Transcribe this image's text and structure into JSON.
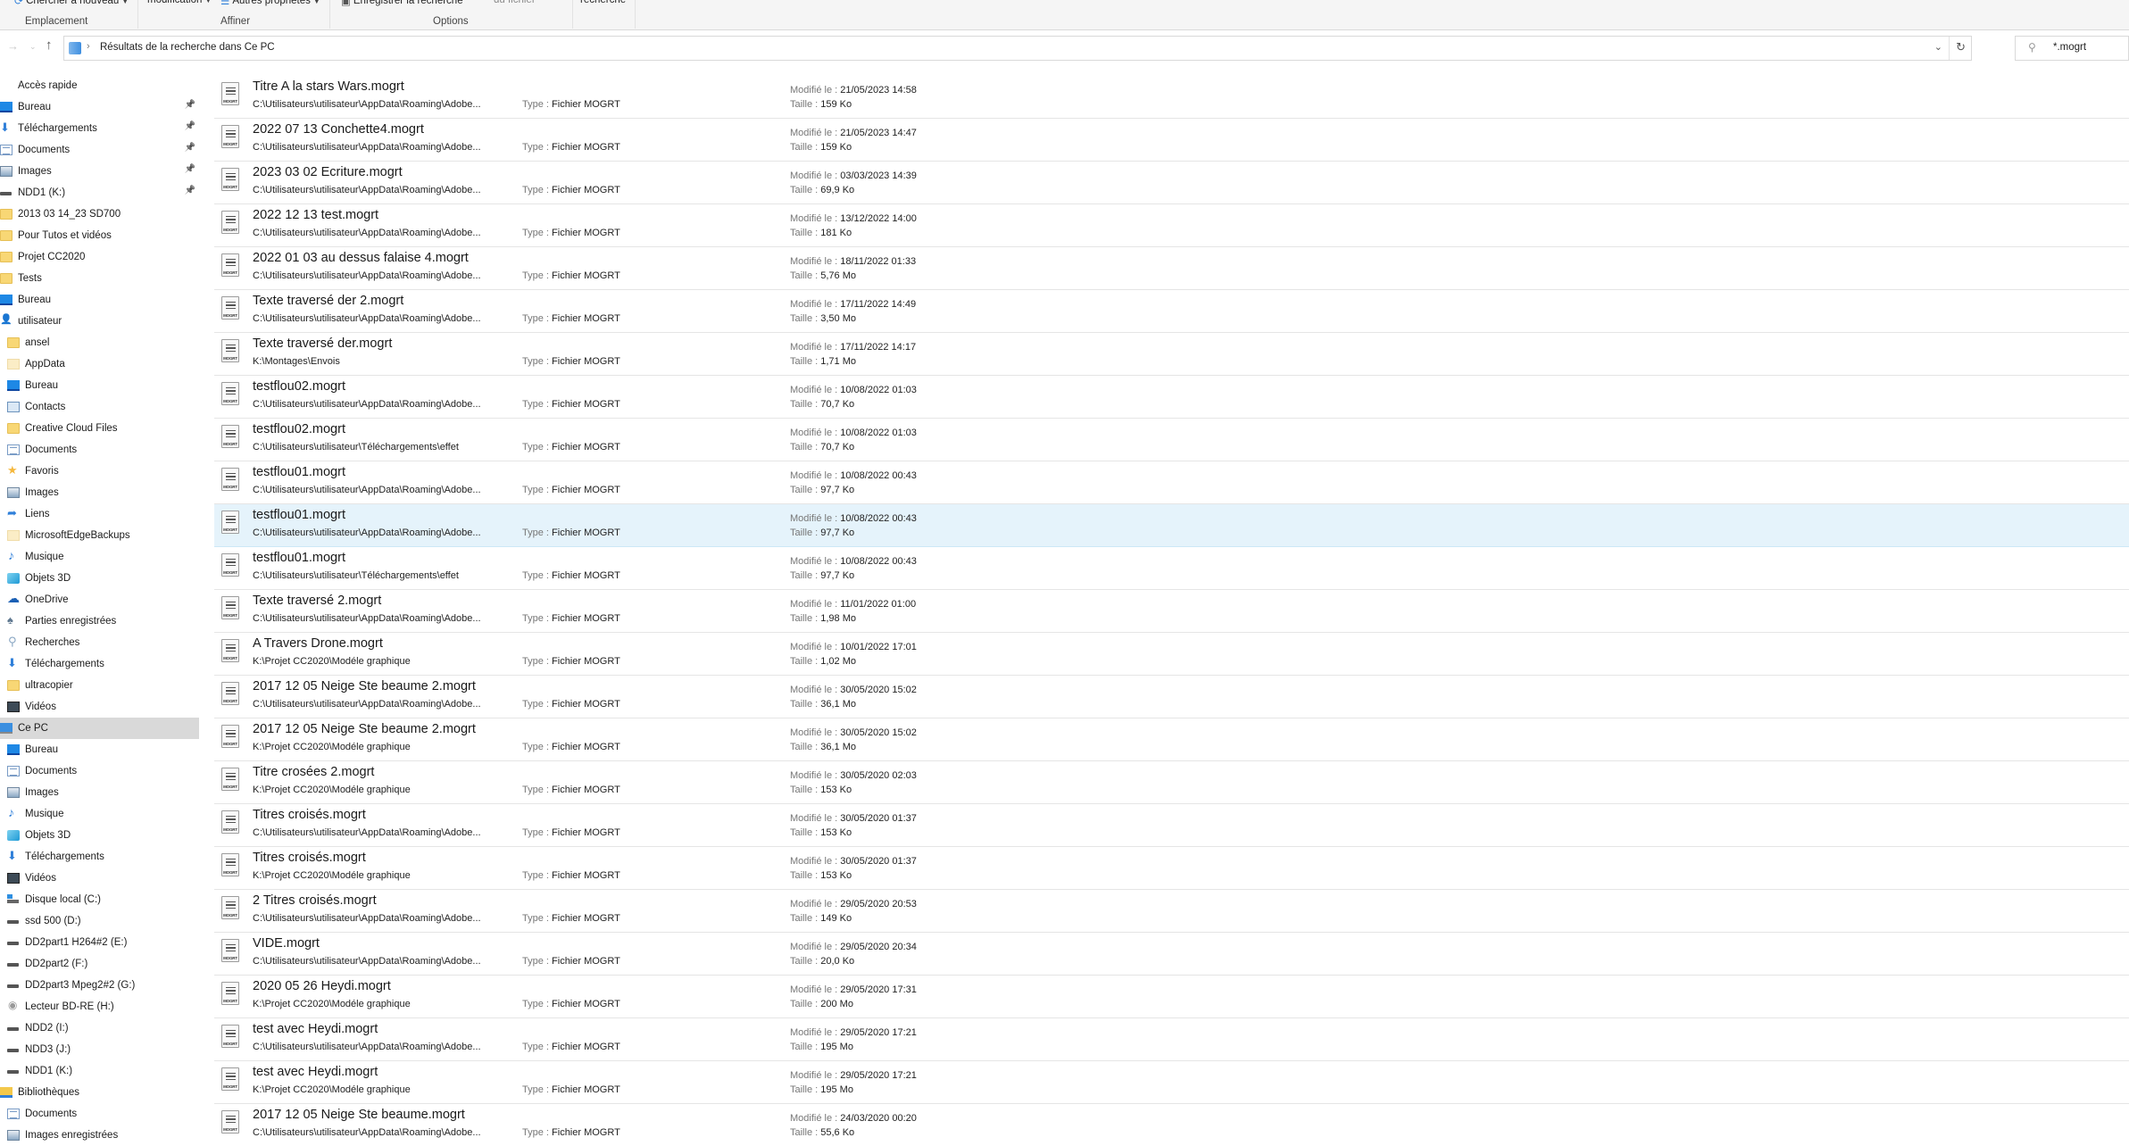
{
  "ribbon": {
    "groups": [
      {
        "caption": "Emplacement",
        "buttons": [
          {
            "label": "Chercher à nouveau",
            "icon": "search-again-icon",
            "dropdown": true
          }
        ]
      },
      {
        "caption": "Affiner",
        "buttons": [
          {
            "label": "modification",
            "dropdown": true
          },
          {
            "label": "Autres propriétés",
            "icon": "properties-icon",
            "dropdown": true
          }
        ]
      },
      {
        "caption": "Options",
        "buttons": [
          {
            "label": "Enregistrer la recherche",
            "icon": "save-icon"
          },
          {
            "label": "du fichier",
            "disabled": true
          }
        ]
      },
      {
        "caption": "",
        "buttons": [
          {
            "label": "recherche"
          }
        ]
      }
    ]
  },
  "nav": {
    "breadcrumb": "Résultats de la recherche dans Ce PC",
    "search_value": "*.mogrt"
  },
  "sidebar": {
    "items": [
      {
        "label": "Accès rapide",
        "icon": "quick-access",
        "level": 0
      },
      {
        "label": "Bureau",
        "icon": "desktop",
        "level": 1,
        "pinned": true
      },
      {
        "label": "Téléchargements",
        "icon": "download",
        "level": 1,
        "pinned": true
      },
      {
        "label": "Documents",
        "icon": "doc",
        "level": 1,
        "pinned": true
      },
      {
        "label": "Images",
        "icon": "images",
        "level": 1,
        "pinned": true
      },
      {
        "label": "NDD1 (K:)",
        "icon": "drive",
        "level": 1,
        "pinned": true
      },
      {
        "label": "2013 03 14_23 SD700",
        "icon": "folder",
        "level": 1
      },
      {
        "label": "Pour Tutos et vidéos",
        "icon": "folder",
        "level": 1
      },
      {
        "label": "Projet CC2020",
        "icon": "folder",
        "level": 1
      },
      {
        "label": "Tests",
        "icon": "folder",
        "level": 1
      },
      {
        "label": "Bureau",
        "icon": "desktop",
        "level": 0
      },
      {
        "label": "utilisateur",
        "icon": "user",
        "level": 1
      },
      {
        "label": "ansel",
        "icon": "folder",
        "level": 2
      },
      {
        "label": "AppData",
        "icon": "folder-light",
        "level": 2
      },
      {
        "label": "Bureau",
        "icon": "desktop",
        "level": 2
      },
      {
        "label": "Contacts",
        "icon": "contacts",
        "level": 2
      },
      {
        "label": "Creative Cloud Files",
        "icon": "folder",
        "level": 2
      },
      {
        "label": "Documents",
        "icon": "doc",
        "level": 2
      },
      {
        "label": "Favoris",
        "icon": "star",
        "level": 2
      },
      {
        "label": "Images",
        "icon": "images",
        "level": 2
      },
      {
        "label": "Liens",
        "icon": "link",
        "level": 2
      },
      {
        "label": "MicrosoftEdgeBackups",
        "icon": "folder-light",
        "level": 2
      },
      {
        "label": "Musique",
        "icon": "music",
        "level": 2
      },
      {
        "label": "Objets 3D",
        "icon": "3d",
        "level": 2
      },
      {
        "label": "OneDrive",
        "icon": "onedrive",
        "level": 2
      },
      {
        "label": "Parties enregistrées",
        "icon": "games",
        "level": 2
      },
      {
        "label": "Recherches",
        "icon": "search",
        "level": 2
      },
      {
        "label": "Téléchargements",
        "icon": "download",
        "level": 2
      },
      {
        "label": "ultracopier",
        "icon": "folder",
        "level": 2
      },
      {
        "label": "Vidéos",
        "icon": "video",
        "level": 2
      },
      {
        "label": "Ce PC",
        "icon": "pc",
        "level": 1,
        "selected": true
      },
      {
        "label": "Bureau",
        "icon": "desktop",
        "level": 2
      },
      {
        "label": "Documents",
        "icon": "doc",
        "level": 2
      },
      {
        "label": "Images",
        "icon": "images",
        "level": 2
      },
      {
        "label": "Musique",
        "icon": "music",
        "level": 2
      },
      {
        "label": "Objets 3D",
        "icon": "3d",
        "level": 2
      },
      {
        "label": "Téléchargements",
        "icon": "download",
        "level": 2
      },
      {
        "label": "Vidéos",
        "icon": "video",
        "level": 2
      },
      {
        "label": "Disque local (C:)",
        "icon": "cdrive",
        "level": 2
      },
      {
        "label": "ssd 500 (D:)",
        "icon": "drive",
        "level": 2
      },
      {
        "label": "DD2part1 H264#2 (E:)",
        "icon": "drive",
        "level": 2
      },
      {
        "label": "DD2part2 (F:)",
        "icon": "drive",
        "level": 2
      },
      {
        "label": "DD2part3 Mpeg2#2 (G:)",
        "icon": "drive",
        "level": 2
      },
      {
        "label": "Lecteur BD-RE (H:)",
        "icon": "bd",
        "level": 2
      },
      {
        "label": "NDD2 (I:)",
        "icon": "drive",
        "level": 2
      },
      {
        "label": "NDD3 (J:)",
        "icon": "drive",
        "level": 2
      },
      {
        "label": "NDD1 (K:)",
        "icon": "drive",
        "level": 2
      },
      {
        "label": "Bibliothèques",
        "icon": "libs",
        "level": 1
      },
      {
        "label": "Documents",
        "icon": "doc",
        "level": 2
      },
      {
        "label": "Images enregistrées",
        "icon": "images",
        "level": 2
      }
    ]
  },
  "labels": {
    "type": "Type : ",
    "modified": "Modifié le : ",
    "size": "Taille : ",
    "icon_tag": "MOGRT"
  },
  "files": [
    {
      "name": "Titre A la stars Wars.mogrt",
      "path": "C:\\Utilisateurs\\utilisateur\\AppData\\Roaming\\Adobe...",
      "type": "Fichier MOGRT",
      "modified": "21/05/2023 14:58",
      "size": "159 Ko"
    },
    {
      "name": "2022 07 13 Conchette4.mogrt",
      "path": "C:\\Utilisateurs\\utilisateur\\AppData\\Roaming\\Adobe...",
      "type": "Fichier MOGRT",
      "modified": "21/05/2023 14:47",
      "size": "159 Ko"
    },
    {
      "name": "2023 03 02 Ecriture.mogrt",
      "path": "C:\\Utilisateurs\\utilisateur\\AppData\\Roaming\\Adobe...",
      "type": "Fichier MOGRT",
      "modified": "03/03/2023 14:39",
      "size": "69,9 Ko"
    },
    {
      "name": "2022 12 13 test.mogrt",
      "path": "C:\\Utilisateurs\\utilisateur\\AppData\\Roaming\\Adobe...",
      "type": "Fichier MOGRT",
      "modified": "13/12/2022 14:00",
      "size": "181 Ko"
    },
    {
      "name": "2022 01 03 au dessus falaise 4.mogrt",
      "path": "C:\\Utilisateurs\\utilisateur\\AppData\\Roaming\\Adobe...",
      "type": "Fichier MOGRT",
      "modified": "18/11/2022 01:33",
      "size": "5,76 Mo"
    },
    {
      "name": "Texte traversé der 2.mogrt",
      "path": "C:\\Utilisateurs\\utilisateur\\AppData\\Roaming\\Adobe...",
      "type": "Fichier MOGRT",
      "modified": "17/11/2022 14:49",
      "size": "3,50 Mo"
    },
    {
      "name": "Texte traversé der.mogrt",
      "path": "K:\\Montages\\Envois",
      "type": "Fichier MOGRT",
      "modified": "17/11/2022 14:17",
      "size": "1,71 Mo"
    },
    {
      "name": "testflou02.mogrt",
      "path": "C:\\Utilisateurs\\utilisateur\\AppData\\Roaming\\Adobe...",
      "type": "Fichier MOGRT",
      "modified": "10/08/2022 01:03",
      "size": "70,7 Ko"
    },
    {
      "name": "testflou02.mogrt",
      "path": "C:\\Utilisateurs\\utilisateur\\Téléchargements\\effet",
      "type": "Fichier MOGRT",
      "modified": "10/08/2022 01:03",
      "size": "70,7 Ko"
    },
    {
      "name": "testflou01.mogrt",
      "path": "C:\\Utilisateurs\\utilisateur\\AppData\\Roaming\\Adobe...",
      "type": "Fichier MOGRT",
      "modified": "10/08/2022 00:43",
      "size": "97,7 Ko"
    },
    {
      "name": "testflou01.mogrt",
      "path": "C:\\Utilisateurs\\utilisateur\\AppData\\Roaming\\Adobe...",
      "type": "Fichier MOGRT",
      "modified": "10/08/2022 00:43",
      "size": "97,7 Ko",
      "selected": true
    },
    {
      "name": "testflou01.mogrt",
      "path": "C:\\Utilisateurs\\utilisateur\\Téléchargements\\effet",
      "type": "Fichier MOGRT",
      "modified": "10/08/2022 00:43",
      "size": "97,7 Ko"
    },
    {
      "name": "Texte traversé 2.mogrt",
      "path": "C:\\Utilisateurs\\utilisateur\\AppData\\Roaming\\Adobe...",
      "type": "Fichier MOGRT",
      "modified": "11/01/2022 01:00",
      "size": "1,98 Mo"
    },
    {
      "name": "A Travers Drone.mogrt",
      "path": "K:\\Projet CC2020\\Modéle graphique",
      "type": "Fichier MOGRT",
      "modified": "10/01/2022 17:01",
      "size": "1,02 Mo"
    },
    {
      "name": "2017 12 05 Neige Ste beaume 2.mogrt",
      "path": "C:\\Utilisateurs\\utilisateur\\AppData\\Roaming\\Adobe...",
      "type": "Fichier MOGRT",
      "modified": "30/05/2020 15:02",
      "size": "36,1 Mo"
    },
    {
      "name": "2017 12 05 Neige Ste beaume 2.mogrt",
      "path": "K:\\Projet CC2020\\Modéle graphique",
      "type": "Fichier MOGRT",
      "modified": "30/05/2020 15:02",
      "size": "36,1 Mo"
    },
    {
      "name": "Titre crosées 2.mogrt",
      "path": "K:\\Projet CC2020\\Modéle graphique",
      "type": "Fichier MOGRT",
      "modified": "30/05/2020 02:03",
      "size": "153 Ko"
    },
    {
      "name": "Titres croisés.mogrt",
      "path": "C:\\Utilisateurs\\utilisateur\\AppData\\Roaming\\Adobe...",
      "type": "Fichier MOGRT",
      "modified": "30/05/2020 01:37",
      "size": "153 Ko"
    },
    {
      "name": "Titres croisés.mogrt",
      "path": "K:\\Projet CC2020\\Modéle graphique",
      "type": "Fichier MOGRT",
      "modified": "30/05/2020 01:37",
      "size": "153 Ko"
    },
    {
      "name": "2 Titres croisés.mogrt",
      "path": "C:\\Utilisateurs\\utilisateur\\AppData\\Roaming\\Adobe...",
      "type": "Fichier MOGRT",
      "modified": "29/05/2020 20:53",
      "size": "149 Ko"
    },
    {
      "name": "VIDE.mogrt",
      "path": "C:\\Utilisateurs\\utilisateur\\AppData\\Roaming\\Adobe...",
      "type": "Fichier MOGRT",
      "modified": "29/05/2020 20:34",
      "size": "20,0 Ko"
    },
    {
      "name": "2020 05 26 Heydi.mogrt",
      "path": "K:\\Projet CC2020\\Modéle graphique",
      "type": "Fichier MOGRT",
      "modified": "29/05/2020 17:31",
      "size": "200 Mo"
    },
    {
      "name": "test avec Heydi.mogrt",
      "path": "C:\\Utilisateurs\\utilisateur\\AppData\\Roaming\\Adobe...",
      "type": "Fichier MOGRT",
      "modified": "29/05/2020 17:21",
      "size": "195 Mo"
    },
    {
      "name": "test avec Heydi.mogrt",
      "path": "K:\\Projet CC2020\\Modéle graphique",
      "type": "Fichier MOGRT",
      "modified": "29/05/2020 17:21",
      "size": "195 Mo"
    },
    {
      "name": "2017 12 05 Neige Ste beaume.mogrt",
      "path": "C:\\Utilisateurs\\utilisateur\\AppData\\Roaming\\Adobe...",
      "type": "Fichier MOGRT",
      "modified": "24/03/2020 00:20",
      "size": "55,6 Ko"
    }
  ]
}
